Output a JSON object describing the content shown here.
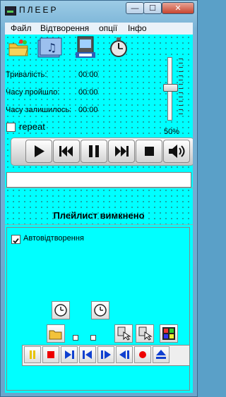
{
  "window": {
    "title": "ПЛЕЕР",
    "min_glyph": "—",
    "max_glyph": "☐",
    "close_glyph": "✕"
  },
  "menu": {
    "items": [
      "Файл",
      "Відтворення",
      "опції",
      "Інфо"
    ]
  },
  "toolbar": {
    "icons": [
      "open-folder-icon",
      "music-file-icon",
      "playlist-icon",
      "stopwatch-icon"
    ]
  },
  "info": {
    "duration_label": "Тривалість:",
    "duration_value": "00:00",
    "elapsed_label": "Часу пройшло:",
    "elapsed_value": "00:00",
    "remaining_label": "Часу залишилось:",
    "remaining_value": "00:00"
  },
  "volume": {
    "label": "50%",
    "level": 0.5
  },
  "repeat": {
    "label": "repeat",
    "checked": false
  },
  "transport": {
    "buttons": [
      "play",
      "previous",
      "pause",
      "next",
      "stop",
      "volume"
    ]
  },
  "playlist": {
    "status_text": "Плейлист вимкнено",
    "autoplay_label": "Автовідтворення",
    "autoplay_checked": true
  },
  "colors": {
    "client_bg": "#00ffff",
    "titlebar": "#7ab3d6",
    "close": "#c7442e"
  }
}
